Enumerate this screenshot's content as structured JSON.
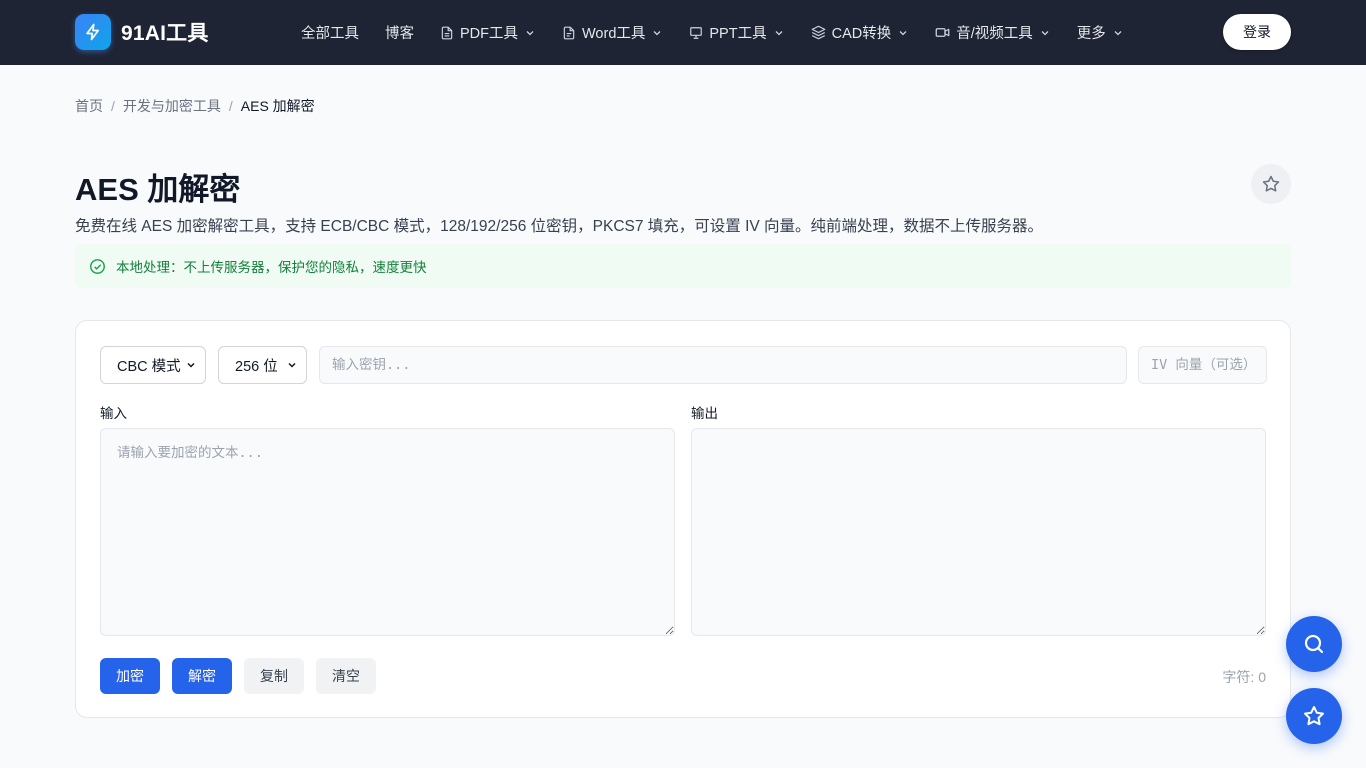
{
  "header": {
    "logo_text": "91AI工具",
    "nav": [
      {
        "label": "全部工具",
        "icon": "",
        "dropdown": false
      },
      {
        "label": "博客",
        "icon": "",
        "dropdown": false
      },
      {
        "label": "PDF工具",
        "icon": "file-icon",
        "dropdown": true
      },
      {
        "label": "Word工具",
        "icon": "file-text-icon",
        "dropdown": true
      },
      {
        "label": "PPT工具",
        "icon": "presentation-icon",
        "dropdown": true
      },
      {
        "label": "CAD转换",
        "icon": "layers-icon",
        "dropdown": true
      },
      {
        "label": "音/视频工具",
        "icon": "video-icon",
        "dropdown": true
      },
      {
        "label": "更多",
        "icon": "",
        "dropdown": true
      }
    ],
    "login_label": "登录"
  },
  "breadcrumb": {
    "home": "首页",
    "category": "开发与加密工具",
    "current": "AES 加解密",
    "separator": "/"
  },
  "page": {
    "title": "AES 加解密",
    "description": "免费在线 AES 加密解密工具，支持 ECB/CBC 模式，128/192/256 位密钥，PKCS7 填充，可设置 IV 向量。纯前端处理，数据不上传服务器。",
    "notice": "本地处理：不上传服务器，保护您的隐私，速度更快"
  },
  "tool": {
    "mode_select": "CBC 模式",
    "keysize_select": "256 位",
    "key_placeholder": "输入密钥...",
    "iv_placeholder": "IV 向量（可选）",
    "input_label": "输入",
    "input_placeholder": "请输入要加密的文本...",
    "output_label": "输出",
    "encrypt_label": "加密",
    "decrypt_label": "解密",
    "copy_label": "复制",
    "clear_label": "清空",
    "char_count": "字符: 0"
  },
  "colors": {
    "header_bg": "#1e2433",
    "primary": "#2563eb",
    "notice_bg": "#effbf3",
    "notice_text": "#15803d"
  }
}
